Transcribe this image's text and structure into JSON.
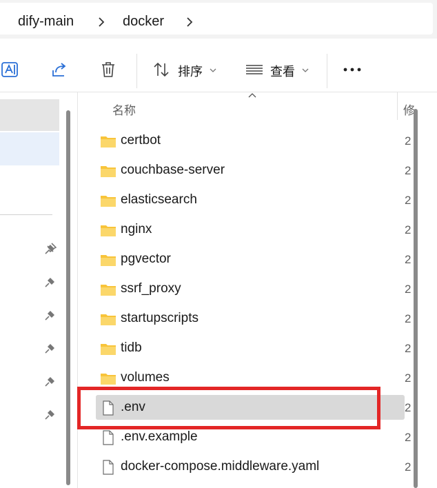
{
  "breadcrumb": {
    "items": [
      "dify-main",
      "docker"
    ]
  },
  "toolbar": {
    "sort_label": "排序",
    "view_label": "查看",
    "icons": [
      "rename-icon",
      "share-icon",
      "delete-icon",
      "sort-icon",
      "view-icon",
      "more-icon"
    ]
  },
  "list": {
    "column_name": "名称",
    "column_second": "修",
    "selected_item": ".env",
    "items": [
      {
        "name": "certbot",
        "type": "folder",
        "trail": "2"
      },
      {
        "name": "couchbase-server",
        "type": "folder",
        "trail": "2"
      },
      {
        "name": "elasticsearch",
        "type": "folder",
        "trail": "2"
      },
      {
        "name": "nginx",
        "type": "folder",
        "trail": "2"
      },
      {
        "name": "pgvector",
        "type": "folder",
        "trail": "2"
      },
      {
        "name": "ssrf_proxy",
        "type": "folder",
        "trail": "2"
      },
      {
        "name": "startupscripts",
        "type": "folder",
        "trail": "2"
      },
      {
        "name": "tidb",
        "type": "folder",
        "trail": "2"
      },
      {
        "name": "volumes",
        "type": "folder",
        "trail": "2"
      },
      {
        "name": ".env",
        "type": "file",
        "trail": "2"
      },
      {
        "name": ".env.example",
        "type": "file",
        "trail": "2"
      },
      {
        "name": "docker-compose.middleware.yaml",
        "type": "file",
        "trail": "2"
      }
    ]
  },
  "colors": {
    "highlight": "#e32626",
    "folder": "#f8c43a",
    "selected_row": "#d9d9d9"
  }
}
